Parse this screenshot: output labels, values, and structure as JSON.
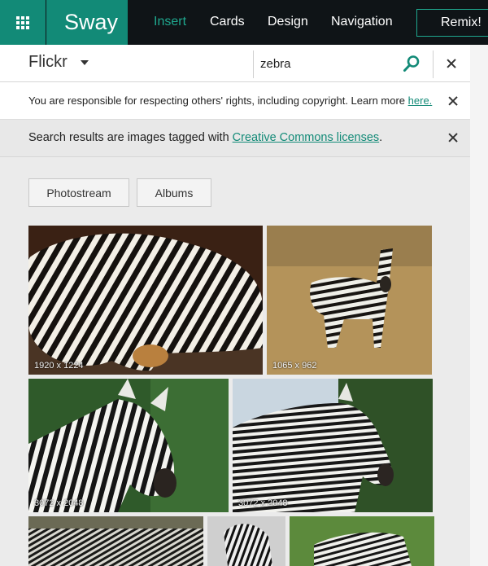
{
  "topbar": {
    "brand": "Sway",
    "nav": [
      {
        "label": "Insert",
        "active": true
      },
      {
        "label": "Cards",
        "active": false
      },
      {
        "label": "Design",
        "active": false
      },
      {
        "label": "Navigation",
        "active": false
      }
    ],
    "remix_label": "Remix!"
  },
  "search": {
    "source": "Flickr",
    "query": "zebra"
  },
  "notices": {
    "rights_text": "You are responsible for respecting others' rights, including copyright. Learn more ",
    "rights_link": "here.",
    "cc_text": "Search results are images tagged with ",
    "cc_link": "Creative Commons licenses",
    "cc_end": "."
  },
  "filters": {
    "photostream": "Photostream",
    "albums": "Albums"
  },
  "results": [
    {
      "dimensions": "1920 x 1224"
    },
    {
      "dimensions": "1065 x 962"
    },
    {
      "dimensions": "3072 x 2048"
    },
    {
      "dimensions": "3072 x 2048"
    },
    {
      "dimensions": ""
    },
    {
      "dimensions": ""
    },
    {
      "dimensions": ""
    }
  ],
  "colors": {
    "accent": "#128a77",
    "topbar_bg": "#0f1417",
    "active_nav": "#1fa88f"
  }
}
